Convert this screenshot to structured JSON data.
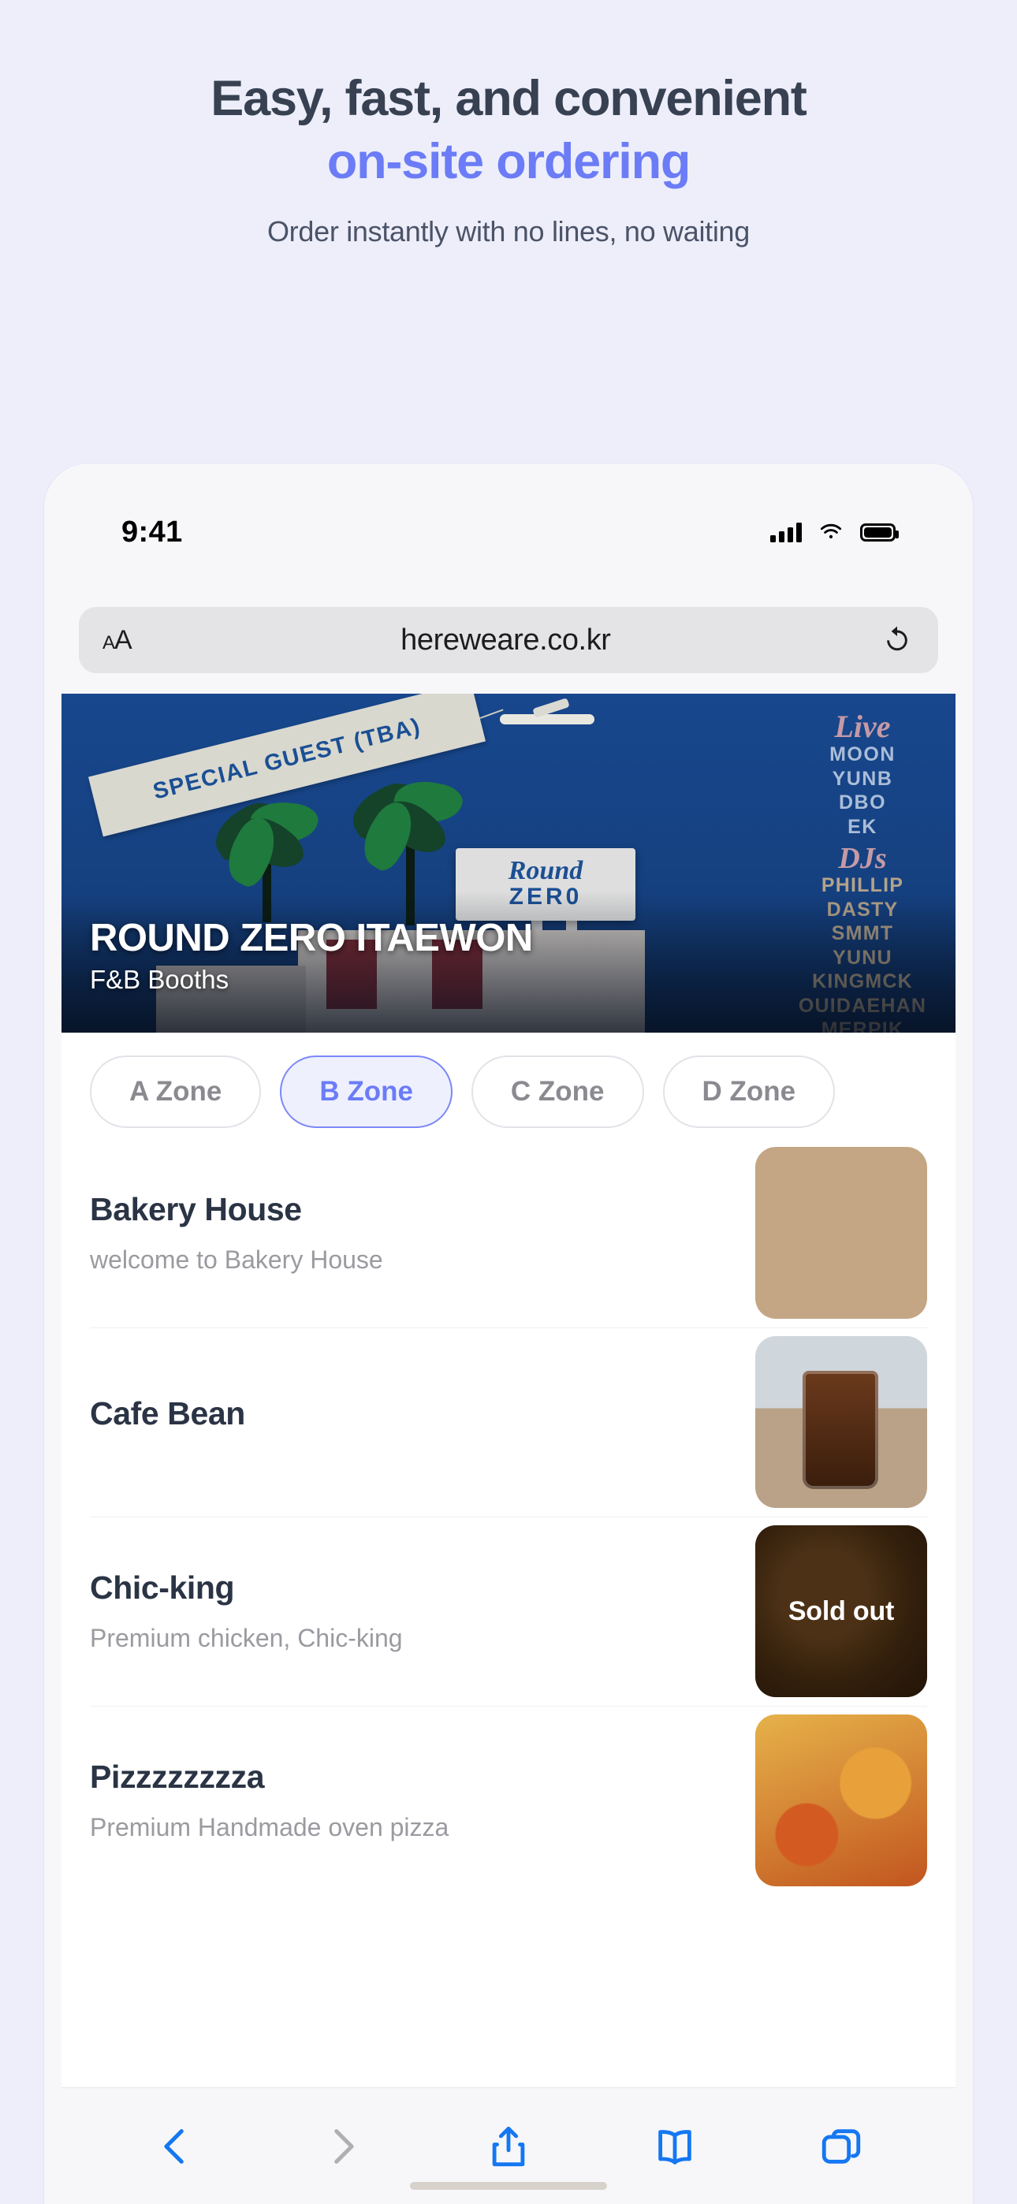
{
  "hero": {
    "headline_line1": "Easy, fast, and convenient",
    "headline_line2": "on-site ordering",
    "subheadline": "Order instantly with no lines, no waiting",
    "accent_color": "#6b7cf6",
    "headline_color": "#374151",
    "background_color": "#edeefa"
  },
  "phone": {
    "status_bar": {
      "time": "9:41",
      "signal_icon": "cellular-bars-icon",
      "wifi_icon": "wifi-icon",
      "battery_icon": "battery-full-icon"
    },
    "browser": {
      "text_size_label": "AA",
      "url": "hereweare.co.kr",
      "reload_icon": "reload-icon",
      "toolbar": [
        {
          "name": "back",
          "icon": "chevron-left-icon",
          "enabled": true
        },
        {
          "name": "forward",
          "icon": "chevron-right-icon",
          "enabled": false
        },
        {
          "name": "share",
          "icon": "share-icon",
          "enabled": true
        },
        {
          "name": "bookmarks",
          "icon": "book-icon",
          "enabled": true
        },
        {
          "name": "tabs",
          "icon": "tabs-icon",
          "enabled": true
        }
      ]
    }
  },
  "banner": {
    "title": "ROUND ZERO ITAEWON",
    "subtitle": "F&B Booths",
    "ribbon_text": "SPECIAL GUEST (TBA)",
    "venue_sign_line1": "Round",
    "venue_sign_line2": "ZER0",
    "lineup": {
      "live_label": "Live",
      "live_artists": [
        "MOON",
        "YUNB",
        "DBO",
        "EK"
      ],
      "djs_label": "DJs",
      "dj_artists": [
        "PHILLIP",
        "DASTY",
        "SMMT",
        "YUNU",
        "KINGMCK",
        "OUIDAEHAN",
        "MERPIK"
      ]
    }
  },
  "zones": {
    "items": [
      {
        "label": "A Zone",
        "selected": false
      },
      {
        "label": "B Zone",
        "selected": true
      },
      {
        "label": "C Zone",
        "selected": false
      },
      {
        "label": "D Zone",
        "selected": false
      }
    ]
  },
  "booths": [
    {
      "name": "Bakery House",
      "desc": "welcome to Bakery House",
      "sold_out": false,
      "badge": "",
      "thumb": "bakery-thumb"
    },
    {
      "name": "Cafe Bean",
      "desc": "",
      "sold_out": false,
      "badge": "",
      "thumb": "cafe-thumb"
    },
    {
      "name": "Chic-king",
      "desc": "Premium chicken, Chic-king",
      "sold_out": true,
      "badge": "Sold out",
      "thumb": "chicken-thumb"
    },
    {
      "name": "Pizzzzzzzza",
      "desc": "Premium Handmade oven pizza",
      "sold_out": false,
      "badge": "",
      "thumb": "pizza-thumb"
    }
  ]
}
